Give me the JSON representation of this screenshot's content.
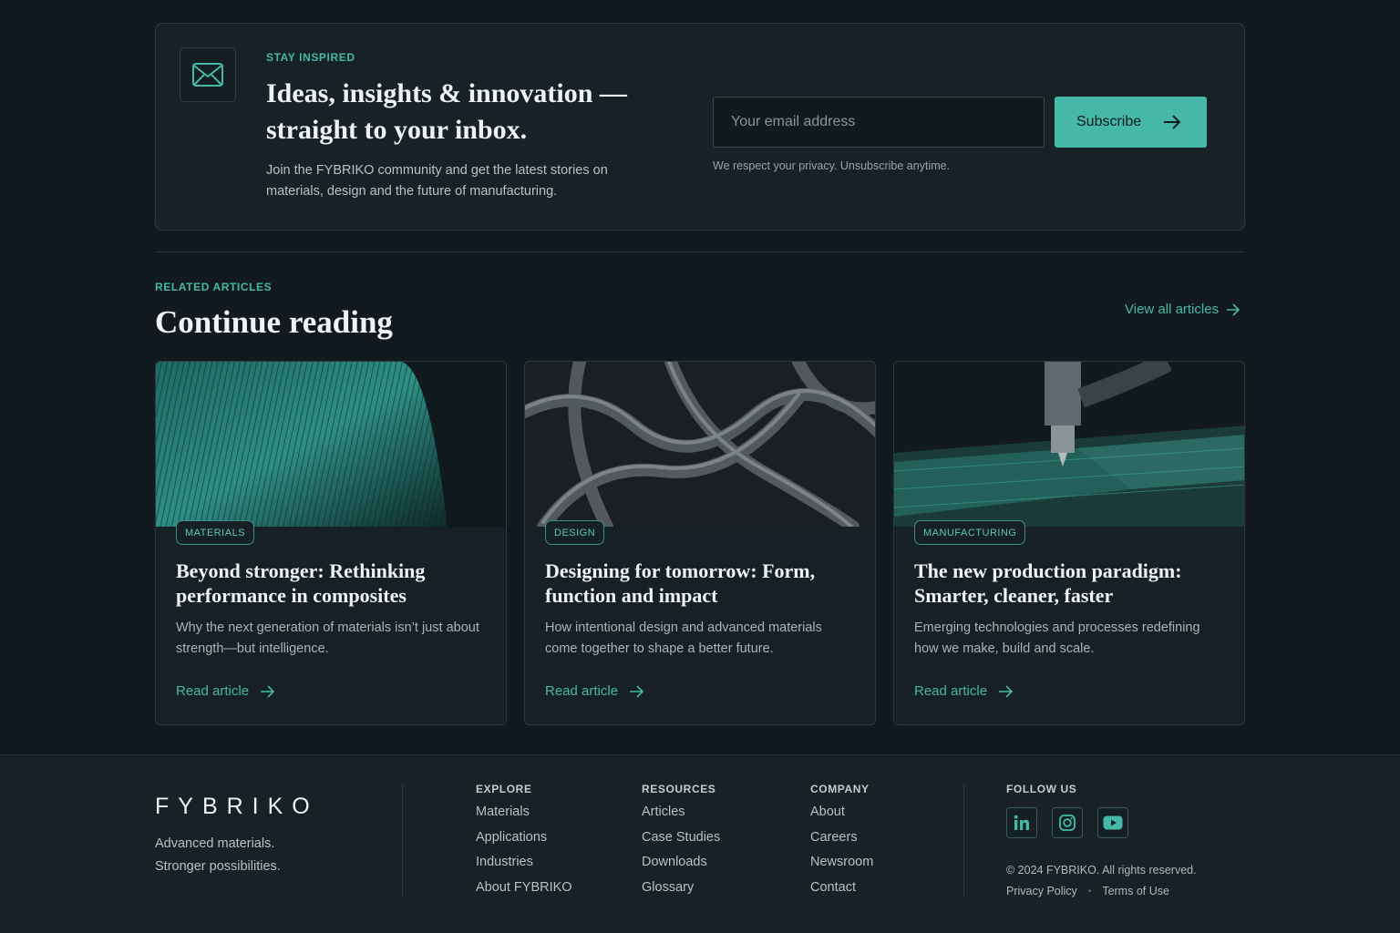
{
  "newsletter": {
    "eyebrow": "STAY INSPIRED",
    "title": "Ideas, insights & innovation — straight to your inbox.",
    "description": "Join the FYBRIKO community and get the latest stories on materials, design and the future of manufacturing.",
    "email_placeholder": "Your email address",
    "subscribe_label": "Subscribe",
    "privacy_note": "We respect your privacy. Unsubscribe anytime.",
    "icon": "envelope-icon"
  },
  "related": {
    "eyebrow": "RELATED ARTICLES",
    "title": "Continue reading",
    "view_all_label": "View all articles",
    "articles": [
      {
        "tag": "MATERIALS",
        "title": "Beyond stronger: Rethinking performance in composites",
        "description": "Why the next generation of materials isn’t just about strength—but intelligence.",
        "link_label": "Read article"
      },
      {
        "tag": "DESIGN",
        "title": "Designing for tomorrow: Form, function and impact",
        "description": "How intentional design and advanced materials come together to shape a better future.",
        "link_label": "Read article"
      },
      {
        "tag": "MANUFACTURING",
        "title": "The new production paradigm: Smarter, cleaner, faster",
        "description": "Emerging technologies and processes redefining how we make, build and scale.",
        "link_label": "Read article"
      }
    ]
  },
  "footer": {
    "logo": "FYBRIKO",
    "tagline_line1": "Advanced materials.",
    "tagline_line2": "Stronger possibilities.",
    "explore": {
      "heading": "EXPLORE",
      "links": [
        "Materials",
        "Applications",
        "Industries",
        "About FYBRIKO"
      ]
    },
    "resources": {
      "heading": "RESOURCES",
      "links": [
        "Articles",
        "Case Studies",
        "Downloads",
        "Glossary"
      ]
    },
    "company": {
      "heading": "COMPANY",
      "links": [
        "About",
        "Careers",
        "Newsroom",
        "Contact"
      ]
    },
    "follow": {
      "heading": "FOLLOW US",
      "icons": [
        "linkedin-icon",
        "instagram-icon",
        "youtube-icon"
      ]
    },
    "copyright": "© 2024 FYBRIKO. All rights reserved.",
    "privacy_label": "Privacy Policy",
    "terms_label": "Terms of Use"
  },
  "colors": {
    "background": "#131a1f",
    "accent": "#46b8a8",
    "panel": "#172126"
  }
}
